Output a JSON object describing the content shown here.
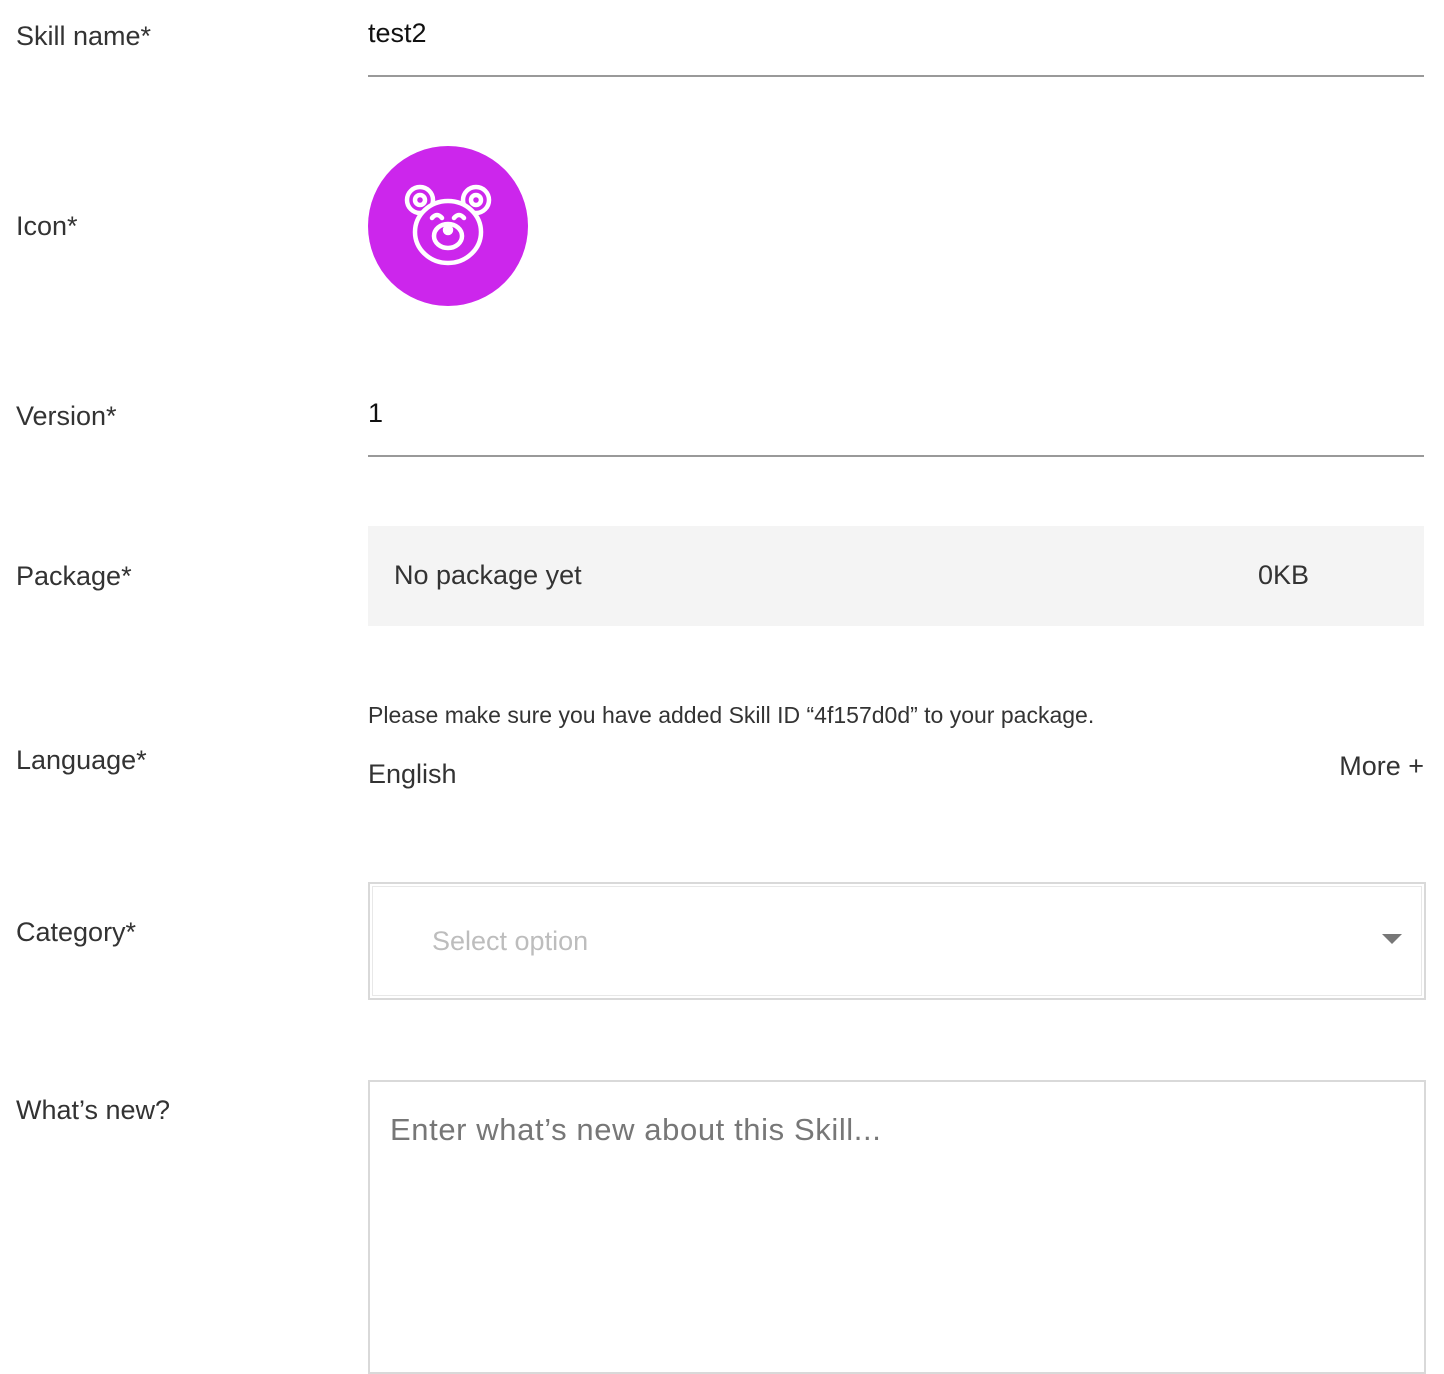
{
  "form": {
    "skill_name": {
      "label": "Skill name*",
      "value": "test2"
    },
    "icon": {
      "label": "Icon*",
      "icon_name": "bear-face-icon",
      "background_color": "#cc26ec"
    },
    "version": {
      "label": "Version*",
      "value": "1"
    },
    "package": {
      "label": "Package*",
      "status": "No package yet",
      "size": "0KB"
    },
    "language": {
      "label": "Language*",
      "note": "Please make sure you have added Skill ID “4f157d0d” to your package.",
      "value": "English",
      "more_label": "More +"
    },
    "category": {
      "label": "Category*",
      "placeholder": "Select option"
    },
    "whats_new": {
      "label": "What’s new?",
      "placeholder": "Enter what’s new about this Skill..."
    }
  }
}
